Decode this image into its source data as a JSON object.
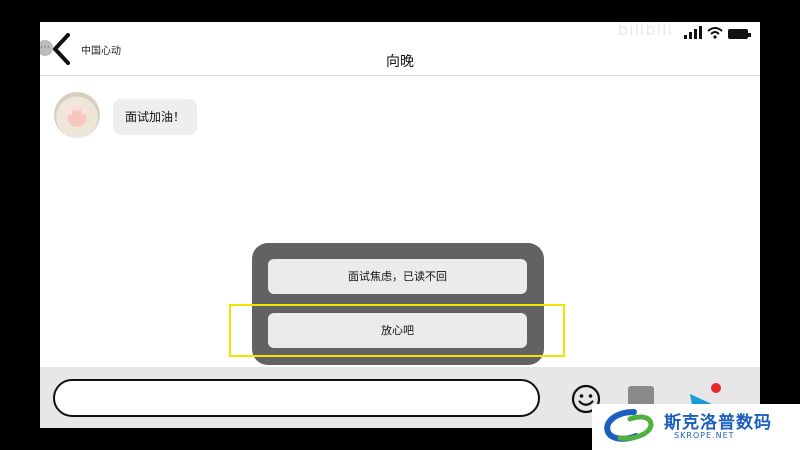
{
  "status_bar": {
    "watermark_text": "bilibili",
    "icons": [
      "signal-icon",
      "wifi-icon",
      "battery-icon"
    ]
  },
  "header": {
    "app_name": "中国心动",
    "title": "向晚",
    "back_icon": "chevron-left-icon"
  },
  "messages": [
    {
      "sender": "向晚",
      "text": "面试加油！"
    }
  ],
  "choices": [
    {
      "label": "面试焦虑，已读不回"
    },
    {
      "label": "放心吧",
      "highlighted": true
    }
  ],
  "input_bar": {
    "message_value": "",
    "icons": [
      "emoji-icon",
      "more-icon",
      "send-icon"
    ]
  },
  "watermark": {
    "name": "斯克洛普数码",
    "domain": "SKROPE.NET"
  },
  "colors": {
    "popup": "#626262",
    "highlight": "#f2e400",
    "logo_blue": "#1c5fbe",
    "send_red": "#e8272f",
    "send_blue": "#1a9ad6"
  }
}
